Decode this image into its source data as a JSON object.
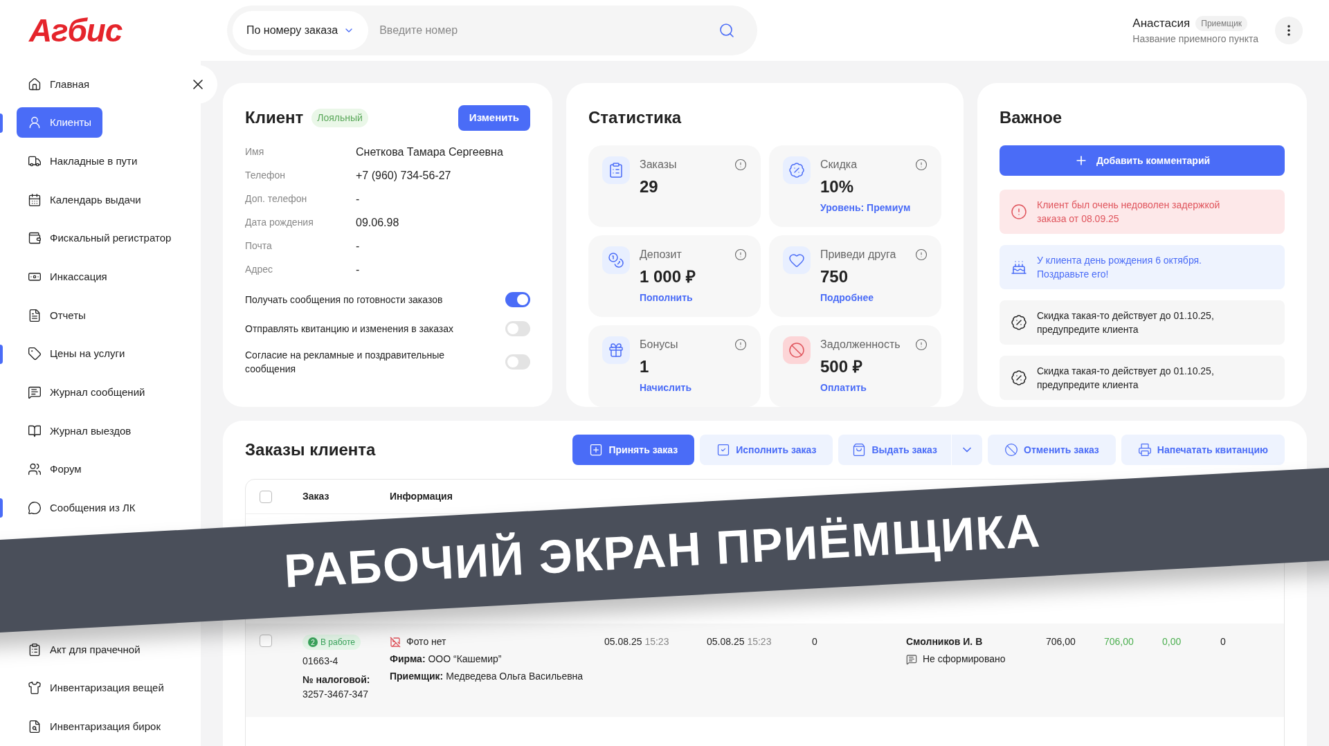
{
  "logo": "Агбис",
  "search": {
    "mode": "По номеру заказа",
    "placeholder": "Введите номер"
  },
  "user": {
    "name": "Анастасия",
    "role": "Приемщик",
    "point": "Название приемного пункта"
  },
  "sidebar": {
    "items": [
      {
        "label": "Главная",
        "selected": false,
        "marked": false
      },
      {
        "label": "Клиенты",
        "selected": true,
        "marked": true
      },
      {
        "label": "Накладные в пути",
        "selected": false,
        "marked": false
      },
      {
        "label": "Календарь выдачи",
        "selected": false,
        "marked": false
      },
      {
        "label": "Фискальный регистратор",
        "selected": false,
        "marked": false
      },
      {
        "label": "Инкассация",
        "selected": false,
        "marked": false
      },
      {
        "label": "Отчеты",
        "selected": false,
        "marked": false
      },
      {
        "label": "Цены на услуги",
        "selected": false,
        "marked": true
      },
      {
        "label": "Журнал сообщений",
        "selected": false,
        "marked": false
      },
      {
        "label": "Журнал выездов",
        "selected": false,
        "marked": false
      },
      {
        "label": "Форум",
        "selected": false,
        "marked": false
      },
      {
        "label": "Сообщения из ЛК",
        "selected": false,
        "marked": true
      }
    ],
    "bottom_items": [
      {
        "label": "Акт для прачечной",
        "selected": false,
        "marked": false
      },
      {
        "label": "Инвентаризация вещей",
        "selected": false,
        "marked": false
      },
      {
        "label": "Инвентаризация бирок",
        "selected": false,
        "marked": false
      }
    ]
  },
  "client": {
    "title": "Клиент",
    "badge": "Лояльный",
    "edit": "Изменить",
    "fields": [
      {
        "label": "Имя",
        "value": "Снеткова Тамара Сергеевна"
      },
      {
        "label": "Телефон",
        "value": "+7 (960) 734-56-27"
      },
      {
        "label": "Доп. телефон",
        "value": "-"
      },
      {
        "label": "Дата рождения",
        "value": "09.06.98"
      },
      {
        "label": "Почта",
        "value": "-"
      },
      {
        "label": "Адрес",
        "value": "-"
      }
    ],
    "toggles": [
      {
        "label": "Получать сообщения по готовности заказов",
        "on": true
      },
      {
        "label": "Отправлять квитанцию и изменения в заказах",
        "on": false
      },
      {
        "label": "Согласие на рекламные и поздравительные сообщения",
        "on": false
      }
    ]
  },
  "stats": {
    "title": "Статистика",
    "tiles": [
      {
        "label": "Заказы",
        "value": "29",
        "kind": "normal"
      },
      {
        "label": "Скидка",
        "value": "10%",
        "link": "Уровень: Премиум",
        "kind": "normal"
      },
      {
        "label": "Депозит",
        "value": "1 000 ₽",
        "link": "Пополнить",
        "kind": "normal"
      },
      {
        "label": "Приведи друга",
        "value": "750",
        "link": "Подробнее",
        "kind": "normal"
      },
      {
        "label": "Бонусы",
        "value": "1",
        "link": "Начислить",
        "kind": "normal"
      },
      {
        "label": "Задолженность",
        "value": "500 ₽",
        "link": "Оплатить",
        "kind": "danger"
      }
    ]
  },
  "important": {
    "title": "Важное",
    "add": "Добавить комментарий",
    "notes": [
      {
        "kind": "alert",
        "text": "Клиент был очень недоволен задержкой заказа от 08.09.25"
      },
      {
        "kind": "birthday",
        "text": "У клиента день рождения 6 октября. Поздравьте его!"
      },
      {
        "kind": "discount",
        "text": "Скидка такая-то действует до 01.10.25, предупредите клиента"
      },
      {
        "kind": "discount",
        "text": "Скидка такая-то действует до 01.10.25, предупредите клиента"
      }
    ]
  },
  "orders": {
    "title": "Заказы клиента",
    "actions": [
      {
        "label": "Принять заказ",
        "kind": "primary"
      },
      {
        "label": "Исполнить заказ",
        "kind": "secondary"
      },
      {
        "label": "Выдать заказ",
        "kind": "split"
      },
      {
        "label": "Отменить заказ",
        "kind": "secondary"
      },
      {
        "label": "Напечатать квитанцию",
        "kind": "secondary"
      }
    ],
    "select_all_checked": false,
    "columns": [
      "Заказ",
      "Информация"
    ],
    "rows": [
      {
        "checked": false,
        "status_count": "2",
        "status": "В работе",
        "number": "01663-4",
        "tax_label": "№ налоговой:",
        "tax": "3257-3467-347",
        "photo": "Фото нет",
        "firm": "**Фирма:** ООО “Кашемир”",
        "receiver": "**Приемщик:** Медведева Ольга Васильевна",
        "accepted_date": "05.08.25",
        "accepted_time": "15:23",
        "due_date": "05.08.25",
        "due_time": "15:23",
        "column_5": "0",
        "executor": "Смолников И. В",
        "comment": "Не сформировано",
        "amounts": [
          {
            "text": "706,00",
            "color": "#222222"
          },
          {
            "text": "706,00",
            "color": "#4caf50"
          },
          {
            "text": "0,00",
            "color": "#4caf50"
          }
        ],
        "column_10": "0"
      }
    ]
  },
  "banner": {
    "text": "РАБОЧИЙ ЭКРАН ПРИЁМЩИКА"
  }
}
